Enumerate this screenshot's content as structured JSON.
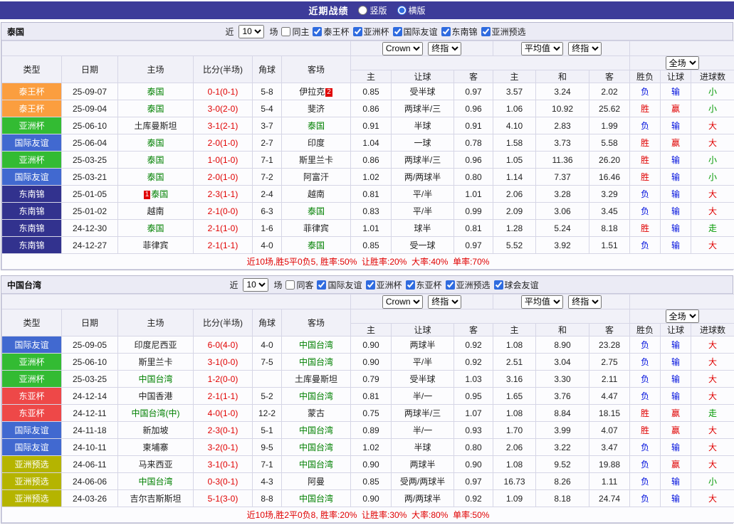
{
  "page": {
    "title": "近期战绩",
    "view_options": [
      {
        "label": "竖版",
        "selected": false
      },
      {
        "label": "横版",
        "selected": true
      }
    ]
  },
  "filter_labels": {
    "near": "近",
    "matches": "场"
  },
  "selects": {
    "match_count": "10",
    "odds_company": "Crown",
    "odds_time": "终指",
    "average": "平均值",
    "avg_time": "终指",
    "scope": "全场"
  },
  "table_columns": {
    "type": "类型",
    "date": "日期",
    "home": "主场",
    "score": "比分(半场)",
    "corner": "角球",
    "away": "客场",
    "odds_home": "主",
    "odds_handicap": "让球",
    "odds_away": "客",
    "avg_home": "主",
    "avg_draw": "和",
    "avg_away": "客",
    "result": "胜负",
    "handicap_result": "让球",
    "goals": "进球数"
  },
  "type_colors": {
    "泰王杯": "#fb9e3f",
    "亚洲杯": "#33bb33",
    "国际友谊": "#4169d0",
    "东南锦": "#32328e",
    "东亚杯": "#ee4848",
    "亚洲预选": "#b5b400"
  },
  "theme": {
    "topbar": "#3d3c99",
    "score": "#e00000",
    "focal": "#008000",
    "marker": "#e00000",
    "summary": "#e00000",
    "win": "#e00000",
    "loss": "#0010dd",
    "push": "#009900",
    "over": "#e00000",
    "under": "#009900"
  },
  "sections": [
    {
      "team": "泰国",
      "same_filter": {
        "label": "同主",
        "checked": false
      },
      "competitions": [
        {
          "label": "泰王杯",
          "checked": true
        },
        {
          "label": "亚洲杯",
          "checked": true
        },
        {
          "label": "国际友谊",
          "checked": true
        },
        {
          "label": "东南锦",
          "checked": true
        },
        {
          "label": "亚洲预选",
          "checked": true
        }
      ],
      "rows": [
        {
          "type": "泰王杯",
          "date": "25-09-07",
          "home": "泰国",
          "home_focal": true,
          "score": "0-1(0-1)",
          "corner": "5-8",
          "away": "伊拉克",
          "away_marker": "2",
          "away_marker_side": "right",
          "odds": [
            "0.85",
            "受半球",
            "0.97"
          ],
          "avg": [
            "3.57",
            "3.24",
            "2.02"
          ],
          "result": "负",
          "result_state": "loss",
          "handicap_result": "输",
          "handicap_state": "loss",
          "goals": "小",
          "goals_state": "under"
        },
        {
          "type": "泰王杯",
          "date": "25-09-04",
          "home": "泰国",
          "home_focal": true,
          "score": "3-0(2-0)",
          "corner": "5-4",
          "away": "斐济",
          "odds": [
            "0.86",
            "两球半/三",
            "0.96"
          ],
          "avg": [
            "1.06",
            "10.92",
            "25.62"
          ],
          "result": "胜",
          "result_state": "win",
          "handicap_result": "赢",
          "handicap_state": "win",
          "goals": "小",
          "goals_state": "under"
        },
        {
          "type": "亚洲杯",
          "date": "25-06-10",
          "home": "土库曼斯坦",
          "score": "3-1(2-1)",
          "corner": "3-7",
          "away": "泰国",
          "away_focal": true,
          "odds": [
            "0.91",
            "半球",
            "0.91"
          ],
          "avg": [
            "4.10",
            "2.83",
            "1.99"
          ],
          "result": "负",
          "result_state": "loss",
          "handicap_result": "输",
          "handicap_state": "loss",
          "goals": "大",
          "goals_state": "over"
        },
        {
          "type": "国际友谊",
          "date": "25-06-04",
          "home": "泰国",
          "home_focal": true,
          "score": "2-0(1-0)",
          "corner": "2-7",
          "away": "印度",
          "odds": [
            "1.04",
            "一球",
            "0.78"
          ],
          "avg": [
            "1.58",
            "3.73",
            "5.58"
          ],
          "result": "胜",
          "result_state": "win",
          "handicap_result": "赢",
          "handicap_state": "win",
          "goals": "大",
          "goals_state": "over"
        },
        {
          "type": "亚洲杯",
          "date": "25-03-25",
          "home": "泰国",
          "home_focal": true,
          "score": "1-0(1-0)",
          "corner": "7-1",
          "away": "斯里兰卡",
          "odds": [
            "0.86",
            "两球半/三",
            "0.96"
          ],
          "avg": [
            "1.05",
            "11.36",
            "26.20"
          ],
          "result": "胜",
          "result_state": "win",
          "handicap_result": "输",
          "handicap_state": "loss",
          "goals": "小",
          "goals_state": "under"
        },
        {
          "type": "国际友谊",
          "date": "25-03-21",
          "home": "泰国",
          "home_focal": true,
          "score": "2-0(1-0)",
          "corner": "7-2",
          "away": "阿富汗",
          "odds": [
            "1.02",
            "两/两球半",
            "0.80"
          ],
          "avg": [
            "1.14",
            "7.37",
            "16.46"
          ],
          "result": "胜",
          "result_state": "win",
          "handicap_result": "输",
          "handicap_state": "loss",
          "goals": "小",
          "goals_state": "under"
        },
        {
          "type": "东南锦",
          "date": "25-01-05",
          "home": "泰国",
          "home_focal": true,
          "home_marker": "1",
          "home_marker_side": "left",
          "score": "2-3(1-1)",
          "corner": "2-4",
          "away": "越南",
          "odds": [
            "0.81",
            "平/半",
            "1.01"
          ],
          "avg": [
            "2.06",
            "3.28",
            "3.29"
          ],
          "result": "负",
          "result_state": "loss",
          "handicap_result": "输",
          "handicap_state": "loss",
          "goals": "大",
          "goals_state": "over"
        },
        {
          "type": "东南锦",
          "date": "25-01-02",
          "home": "越南",
          "score": "2-1(0-0)",
          "corner": "6-3",
          "away": "泰国",
          "away_focal": true,
          "odds": [
            "0.83",
            "平/半",
            "0.99"
          ],
          "avg": [
            "2.09",
            "3.06",
            "3.45"
          ],
          "result": "负",
          "result_state": "loss",
          "handicap_result": "输",
          "handicap_state": "loss",
          "goals": "大",
          "goals_state": "over"
        },
        {
          "type": "东南锦",
          "date": "24-12-30",
          "home": "泰国",
          "home_focal": true,
          "score": "2-1(1-0)",
          "corner": "1-6",
          "away": "菲律宾",
          "odds": [
            "1.01",
            "球半",
            "0.81"
          ],
          "avg": [
            "1.28",
            "5.24",
            "8.18"
          ],
          "result": "胜",
          "result_state": "win",
          "handicap_result": "输",
          "handicap_state": "loss",
          "goals": "走",
          "goals_state": "push"
        },
        {
          "type": "东南锦",
          "date": "24-12-27",
          "home": "菲律宾",
          "score": "2-1(1-1)",
          "corner": "4-0",
          "away": "泰国",
          "away_focal": true,
          "odds": [
            "0.85",
            "受一球",
            "0.97"
          ],
          "avg": [
            "5.52",
            "3.92",
            "1.51"
          ],
          "result": "负",
          "result_state": "loss",
          "handicap_result": "输",
          "handicap_state": "loss",
          "goals": "大",
          "goals_state": "over"
        }
      ],
      "summary": "近10场,胜5平0负5, 胜率:50%  让胜率:20%  大率:40%  单率:70%"
    },
    {
      "team": "中国台湾",
      "same_filter": {
        "label": "同客",
        "checked": false
      },
      "competitions": [
        {
          "label": "国际友谊",
          "checked": true
        },
        {
          "label": "亚洲杯",
          "checked": true
        },
        {
          "label": "东亚杯",
          "checked": true
        },
        {
          "label": "亚洲预选",
          "checked": true
        },
        {
          "label": "球会友谊",
          "checked": true
        }
      ],
      "rows": [
        {
          "type": "国际友谊",
          "date": "25-09-05",
          "home": "印度尼西亚",
          "score": "6-0(4-0)",
          "corner": "4-0",
          "away": "中国台湾",
          "away_focal": true,
          "odds": [
            "0.90",
            "两球半",
            "0.92"
          ],
          "avg": [
            "1.08",
            "8.90",
            "23.28"
          ],
          "result": "负",
          "result_state": "loss",
          "handicap_result": "输",
          "handicap_state": "loss",
          "goals": "大",
          "goals_state": "over"
        },
        {
          "type": "亚洲杯",
          "date": "25-06-10",
          "home": "斯里兰卡",
          "score": "3-1(0-0)",
          "corner": "7-5",
          "away": "中国台湾",
          "away_focal": true,
          "odds": [
            "0.90",
            "平/半",
            "0.92"
          ],
          "avg": [
            "2.51",
            "3.04",
            "2.75"
          ],
          "result": "负",
          "result_state": "loss",
          "handicap_result": "输",
          "handicap_state": "loss",
          "goals": "大",
          "goals_state": "over"
        },
        {
          "type": "亚洲杯",
          "date": "25-03-25",
          "home": "中国台湾",
          "home_focal": true,
          "score": "1-2(0-0)",
          "corner": "",
          "away": "土库曼斯坦",
          "odds": [
            "0.79",
            "受半球",
            "1.03"
          ],
          "avg": [
            "3.16",
            "3.30",
            "2.11"
          ],
          "result": "负",
          "result_state": "loss",
          "handicap_result": "输",
          "handicap_state": "loss",
          "goals": "大",
          "goals_state": "over"
        },
        {
          "type": "东亚杯",
          "date": "24-12-14",
          "home": "中国香港",
          "score": "2-1(1-1)",
          "corner": "5-2",
          "away": "中国台湾",
          "away_focal": true,
          "odds": [
            "0.81",
            "半/一",
            "0.95"
          ],
          "avg": [
            "1.65",
            "3.76",
            "4.47"
          ],
          "result": "负",
          "result_state": "loss",
          "handicap_result": "输",
          "handicap_state": "loss",
          "goals": "大",
          "goals_state": "over"
        },
        {
          "type": "东亚杯",
          "date": "24-12-11",
          "home": "中国台湾(中)",
          "home_focal": true,
          "score": "4-0(1-0)",
          "corner": "12-2",
          "away": "蒙古",
          "odds": [
            "0.75",
            "两球半/三",
            "1.07"
          ],
          "avg": [
            "1.08",
            "8.84",
            "18.15"
          ],
          "result": "胜",
          "result_state": "win",
          "handicap_result": "赢",
          "handicap_state": "win",
          "goals": "走",
          "goals_state": "push"
        },
        {
          "type": "国际友谊",
          "date": "24-11-18",
          "home": "新加坡",
          "score": "2-3(0-1)",
          "corner": "5-1",
          "away": "中国台湾",
          "away_focal": true,
          "odds": [
            "0.89",
            "半/一",
            "0.93"
          ],
          "avg": [
            "1.70",
            "3.99",
            "4.07"
          ],
          "result": "胜",
          "result_state": "win",
          "handicap_result": "赢",
          "handicap_state": "win",
          "goals": "大",
          "goals_state": "over"
        },
        {
          "type": "国际友谊",
          "date": "24-10-11",
          "home": "柬埔寨",
          "score": "3-2(0-1)",
          "corner": "9-5",
          "away": "中国台湾",
          "away_focal": true,
          "odds": [
            "1.02",
            "半球",
            "0.80"
          ],
          "avg": [
            "2.06",
            "3.22",
            "3.47"
          ],
          "result": "负",
          "result_state": "loss",
          "handicap_result": "输",
          "handicap_state": "loss",
          "goals": "大",
          "goals_state": "over"
        },
        {
          "type": "亚洲预选",
          "date": "24-06-11",
          "home": "马来西亚",
          "score": "3-1(0-1)",
          "corner": "7-1",
          "away": "中国台湾",
          "away_focal": true,
          "odds": [
            "0.90",
            "两球半",
            "0.90"
          ],
          "avg": [
            "1.08",
            "9.52",
            "19.88"
          ],
          "result": "负",
          "result_state": "loss",
          "handicap_result": "赢",
          "handicap_state": "win",
          "goals": "大",
          "goals_state": "over"
        },
        {
          "type": "亚洲预选",
          "date": "24-06-06",
          "home": "中国台湾",
          "home_focal": true,
          "score": "0-3(0-1)",
          "corner": "4-3",
          "away": "阿曼",
          "odds": [
            "0.85",
            "受两/两球半",
            "0.97"
          ],
          "avg": [
            "16.73",
            "8.26",
            "1.11"
          ],
          "result": "负",
          "result_state": "loss",
          "handicap_result": "输",
          "handicap_state": "loss",
          "goals": "小",
          "goals_state": "under"
        },
        {
          "type": "亚洲预选",
          "date": "24-03-26",
          "home": "吉尔吉斯斯坦",
          "score": "5-1(3-0)",
          "corner": "8-8",
          "away": "中国台湾",
          "away_focal": true,
          "odds": [
            "0.90",
            "两/两球半",
            "0.92"
          ],
          "avg": [
            "1.09",
            "8.18",
            "24.74"
          ],
          "result": "负",
          "result_state": "loss",
          "handicap_result": "输",
          "handicap_state": "loss",
          "goals": "大",
          "goals_state": "over"
        }
      ],
      "summary": "近10场,胜2平0负8, 胜率:20%  让胜率:30%  大率:80%  单率:50%"
    }
  ]
}
